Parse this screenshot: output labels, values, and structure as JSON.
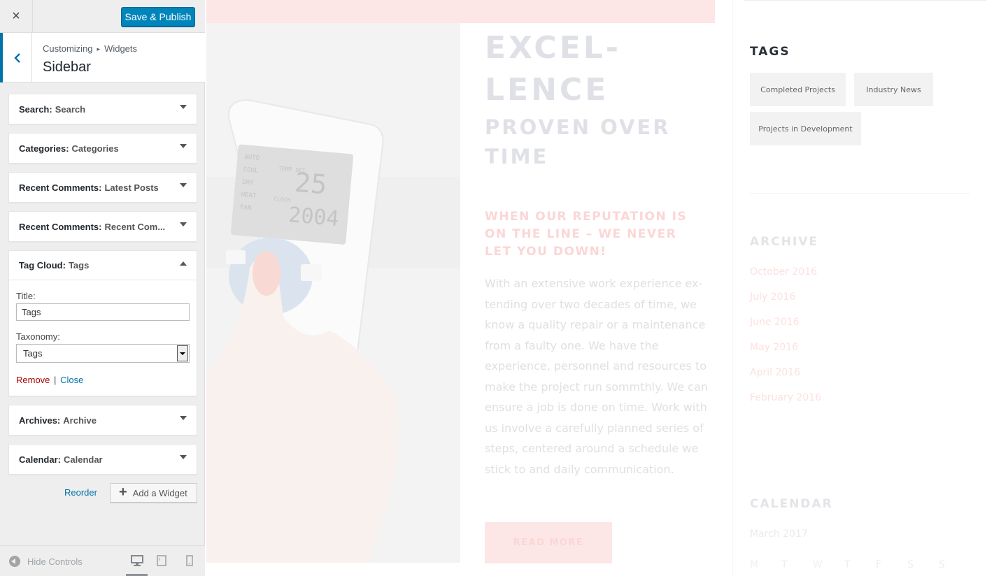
{
  "customizer": {
    "close_icon": "×",
    "save_label": "Save & Publish",
    "breadcrumb": {
      "root": "Customizing",
      "section": "Widgets"
    },
    "panel_title": "Sidebar",
    "widgets": [
      {
        "type": "Search",
        "title": "Search"
      },
      {
        "type": "Categories",
        "title": "Categories"
      },
      {
        "type": "Recent Comments",
        "title": "Latest Posts"
      },
      {
        "type": "Recent Comments",
        "title": "Recent Com..."
      },
      {
        "type": "Tag Cloud",
        "title": "Tags"
      },
      {
        "type": "Archives",
        "title": "Archive"
      },
      {
        "type": "Calendar",
        "title": "Calendar"
      }
    ],
    "tag_form": {
      "title_label": "Title:",
      "title_value": "Tags",
      "taxonomy_label": "Taxonomy:",
      "taxonomy_value": "Tags",
      "remove": "Remove",
      "divider": "|",
      "close": "Close"
    },
    "reorder": "Reorder",
    "add_widget": "Add a Widget",
    "hide_controls": "Hide Controls",
    "accent": "#0073aa",
    "save_color": "#0085ba"
  },
  "preview": {
    "heading_line1": "EXCEL-",
    "heading_line2": "LENCE",
    "subheading_line1": "PROVEN OVER",
    "subheading_line2": "TIME",
    "tagline": "WHEN OUR REPUTATION IS ON THE LINE – WE NEVER LET YOU DOWN!",
    "body": "With an extensive work experience ex-tending over two decades of time, we know a quality repair or a maintenance from a faulty one. We have the experience, personnel and resources to make the project run sommthly. We can ensure a job is done on time. Work with us involve a carefully planned series of steps, centered around a schedule we stick to and daily communication.",
    "read_more": "READ MORE",
    "remote_display": {
      "modes": [
        "AUTO",
        "COOL",
        "DRY",
        "HEAT",
        "FAN"
      ],
      "temp_label": "TEMP SET",
      "temp": "25",
      "clock_label": "CLOCK",
      "clock": "2004"
    },
    "sidebar": {
      "tags_heading": "TAGS",
      "tags": [
        "Completed Projects",
        "Industry News",
        "Projects in Development"
      ],
      "archive_heading": "ARCHIVE",
      "archive_links": [
        "October 2016",
        "July 2016",
        "June 2016",
        "May 2016",
        "April 2016",
        "February 2016"
      ],
      "calendar_heading": "CALENDAR",
      "calendar_month": "March 2017",
      "calendar_days": [
        "M",
        "T",
        "W",
        "T",
        "F",
        "S",
        "S"
      ]
    }
  }
}
